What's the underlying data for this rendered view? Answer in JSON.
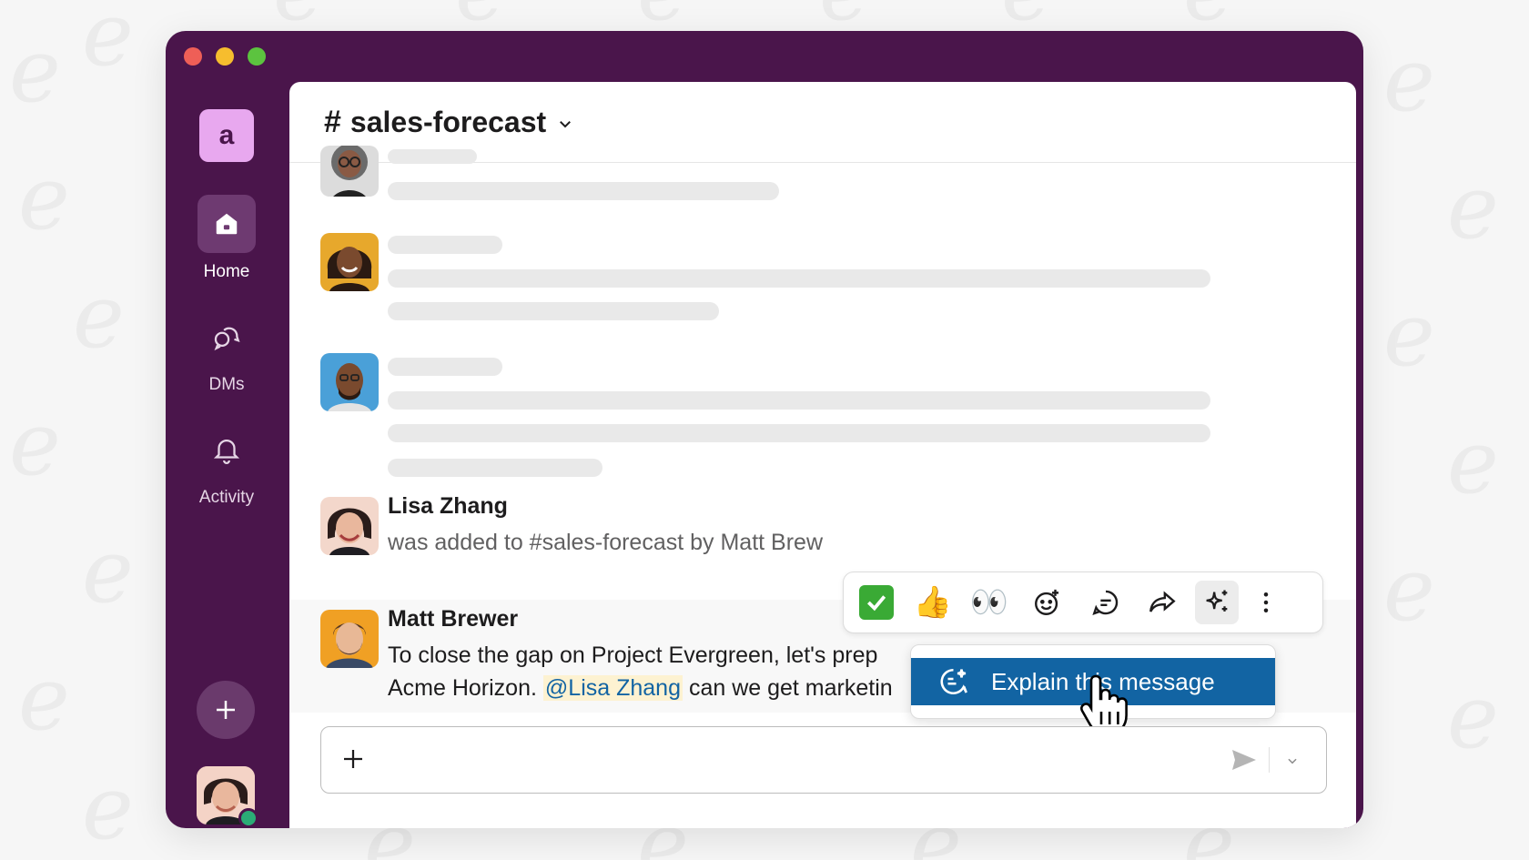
{
  "workspace": {
    "initial": "a"
  },
  "rail": {
    "items": [
      {
        "label": "Home",
        "icon": "home-icon",
        "active": true
      },
      {
        "label": "DMs",
        "icon": "dms-icon",
        "active": false
      },
      {
        "label": "Activity",
        "icon": "bell-icon",
        "active": false
      }
    ]
  },
  "channel": {
    "hash": "#",
    "name": "sales-forecast"
  },
  "messages": {
    "lisa": {
      "name": "Lisa Zhang",
      "text": "was added to #sales-forecast by Matt Brew"
    },
    "matt": {
      "name": "Matt Brewer",
      "line1": "To close the gap on Project Evergreen, let's prep",
      "line2_before": "Acme Horizon.",
      "mention": "@Lisa Zhang",
      "line2_after": "can we get marketin"
    }
  },
  "toolbar": {
    "buttons": [
      "white-check-mark-emoji",
      "thumbs-up-emoji",
      "eyes-emoji",
      "add-reaction-icon",
      "reply-thread-icon",
      "share-icon",
      "ai-sparkle-icon",
      "more-actions-icon"
    ],
    "thumbs": "👍",
    "eyes": "👀"
  },
  "context_menu": {
    "item_label": "Explain this message",
    "item_icon": "ai-explain-icon"
  },
  "colors": {
    "aubergine": "#4a154b",
    "menu_highlight": "#1264a3",
    "check_green": "#3aaa35"
  }
}
